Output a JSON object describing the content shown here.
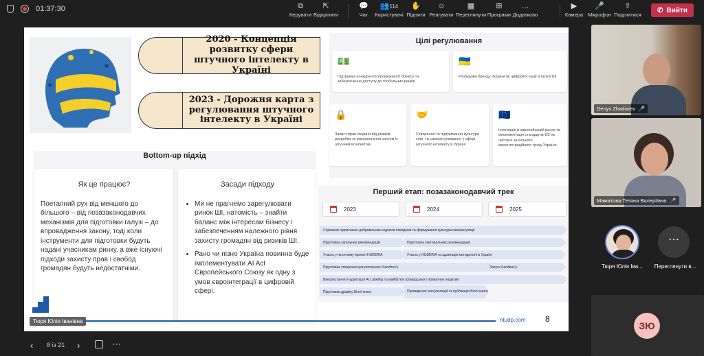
{
  "topbar": {
    "timer": "01:37:30",
    "tools": [
      {
        "label": "Керувати",
        "icon": "control-icon",
        "glyph": "⧉"
      },
      {
        "label": "Відкріпити",
        "icon": "unpin-icon",
        "glyph": "⇱"
      },
      {
        "label": "Чат",
        "icon": "chat-icon",
        "glyph": "💬"
      },
      {
        "label": "Користувачі",
        "icon": "people-icon",
        "glyph": "👥",
        "count": "114"
      },
      {
        "label": "Підняти",
        "icon": "raise-hand-icon",
        "glyph": "✋"
      },
      {
        "label": "Реагувати",
        "icon": "react-icon",
        "glyph": "☺"
      },
      {
        "label": "Переглянути",
        "icon": "view-icon",
        "glyph": "▦"
      },
      {
        "label": "Програми",
        "icon": "apps-icon",
        "glyph": "⊞"
      },
      {
        "label": "Додатково",
        "icon": "more-icon",
        "glyph": "…"
      },
      {
        "label": "Камера",
        "icon": "camera-icon",
        "glyph": "▶"
      },
      {
        "label": "Мікрофон",
        "icon": "mic-icon",
        "glyph": "🎤"
      },
      {
        "label": "Поділитися",
        "icon": "share-icon",
        "glyph": "⇧"
      }
    ],
    "leave_label": "Вийти"
  },
  "slide": {
    "box1_year": "2020",
    "box1_text": " - Концепція розвитку сфери штучного інтелекту в Україні",
    "box2_year": "2023",
    "box2_text": " - Дорожня карта з регулювання штучного інтелекту в Україні",
    "goals_title": "Цілі регулювання",
    "goals": [
      {
        "icon": "💵",
        "text": "Підтримка конкурентоспроможності бізнесу та забезпечення доступу до глобальних ринків"
      },
      {
        "icon": "🇺🇦",
        "text": "Розбудова бренду України як цифрової нації в галузі ШІ"
      },
      {
        "icon": "🔒",
        "text": "Захист прав людини від ризиків розробки та використання систем із штучним інтелектом"
      },
      {
        "icon": "🤝",
        "text": "Створення та підтримання культури спів- та саморегулювання у сфері штучного інтелекту в Україні"
      },
      {
        "icon": "🇪🇺",
        "text": "Інтеграція в європейський ринок та імплементація стандартів ЄС як частина загального євроінтеграційного треку України"
      }
    ],
    "bottomup_title": "Bottom-up підхід",
    "how_title": "Як це працює?",
    "how_text": "Поетапний рух від меншого до більшого – від позазаконодавчих механізмів для підготовки галузі – до впровадження закону, тоді коли інструменти для підготовки будуть надані учасникам ринку, а вже існуючі підходи захисту прав і свобод громадян будуть недостатніми.",
    "principles_title": "Засади підходу",
    "principles": [
      "Ми не прагнемо зарегулювати ринок ШІ, натомість – знайти баланс між інтересам бізнесу і забезпеченням належного рівня захисту громадян від ризиків ШІ.",
      "Рано чи пізно Україна повинна буде імплементувати AI Act Європейського Союзу як одну з умов євроінтеграції в цифровій сфері."
    ],
    "stage_title": "Перший етап: позазаконодавчий трек",
    "years": [
      "2023",
      "2024",
      "2025"
    ],
    "bars": [
      "Сприяння підписанню добровільних кодексів поведінки та формування культури саморегуляції",
      "Підготовка загальних рекомендацій",
      "Підготовка секторальних рекомендацій",
      "Участь у пілотному проекті HUDERIA",
      "Участь у HUDERIA та адаптація методології в Україні",
      "Підготовка створення регуляторного Sandbox'у",
      "Запуск Sandbox'у",
      "Використання й адаптація AI Labeling та майбутніх громадських і приватних ініціатив",
      "Підготовка драфту Білої книги",
      "Проведення консультацій та публікація Білої книги"
    ],
    "presenter_label": "Тюря Юлія Іванівна",
    "footer_url": "ntudp.com",
    "page_number": "8"
  },
  "participants": [
    {
      "name": "Denys Zhadiaiev"
    },
    {
      "name": "Маматова Тетяна Валеріївна"
    },
    {
      "name": "Тюря Юлія Іва..."
    },
    {
      "name": "Переглянути в..."
    }
  ],
  "self_initials": "ЗЮ",
  "bottombar": {
    "page_indicator": "8 із 21"
  },
  "colors": {
    "leave": "#c4314b",
    "accent": "#1e5aa8",
    "arrow_fill": "#f5e6cc"
  }
}
